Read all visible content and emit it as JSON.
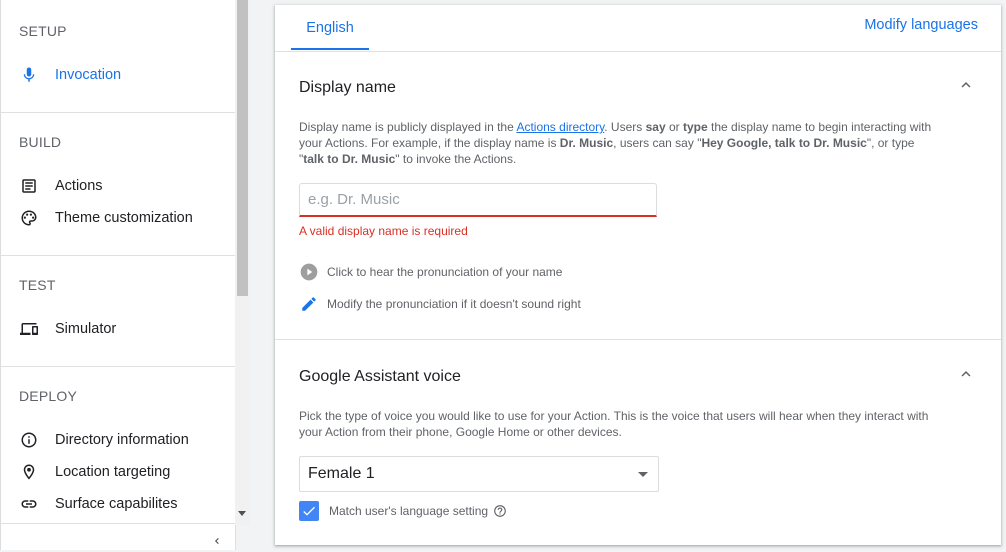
{
  "sidebar": {
    "sections": [
      {
        "heading": "SETUP",
        "items": [
          {
            "label": "Invocation",
            "icon": "mic-icon",
            "active": true
          }
        ]
      },
      {
        "heading": "BUILD",
        "items": [
          {
            "label": "Actions",
            "icon": "list-icon"
          },
          {
            "label": "Theme customization",
            "icon": "palette-icon"
          }
        ]
      },
      {
        "heading": "TEST",
        "items": [
          {
            "label": "Simulator",
            "icon": "devices-icon"
          }
        ]
      },
      {
        "heading": "DEPLOY",
        "items": [
          {
            "label": "Directory information",
            "icon": "info-icon"
          },
          {
            "label": "Location targeting",
            "icon": "location-pin-icon"
          },
          {
            "label": "Surface capabilites",
            "icon": "link-icon"
          }
        ]
      }
    ],
    "collapse_icon": "chevron-left-icon"
  },
  "tabs": {
    "active_tab": "English",
    "modify_link": "Modify languages"
  },
  "display_name": {
    "title": "Display name",
    "desc_1": "Display name is publicly displayed in the ",
    "desc_link": "Actions directory",
    "desc_2": ". Users ",
    "desc_say": "say",
    "desc_3": " or ",
    "desc_type": "type",
    "desc_4": " the display name to begin interacting with your Actions. For example, if the display name is ",
    "desc_example": "Dr. Music",
    "desc_5": ", users can say \"",
    "desc_say_example": "Hey Google, talk to Dr. Music",
    "desc_6": "\", or type \"",
    "desc_type_example": "talk to Dr. Music",
    "desc_7": "\" to invoke the Actions.",
    "input_value": "",
    "input_placeholder": "e.g. Dr. Music",
    "error": "A valid display name is required",
    "play_hint": "Click to hear the pronunciation of your name",
    "modify_hint": "Modify the pronunciation if it doesn't sound right"
  },
  "voice": {
    "title": "Google Assistant voice",
    "description": "Pick the type of voice you would like to use for your Action. This is the voice that users will hear when they interact with your Action from their phone, Google Home or other devices.",
    "selected": "Female 1",
    "match_label": "Match user's language setting",
    "match_checked": true
  },
  "colors": {
    "accent": "#1a73e8",
    "error": "#d93025",
    "checkbox": "#4285f4"
  }
}
